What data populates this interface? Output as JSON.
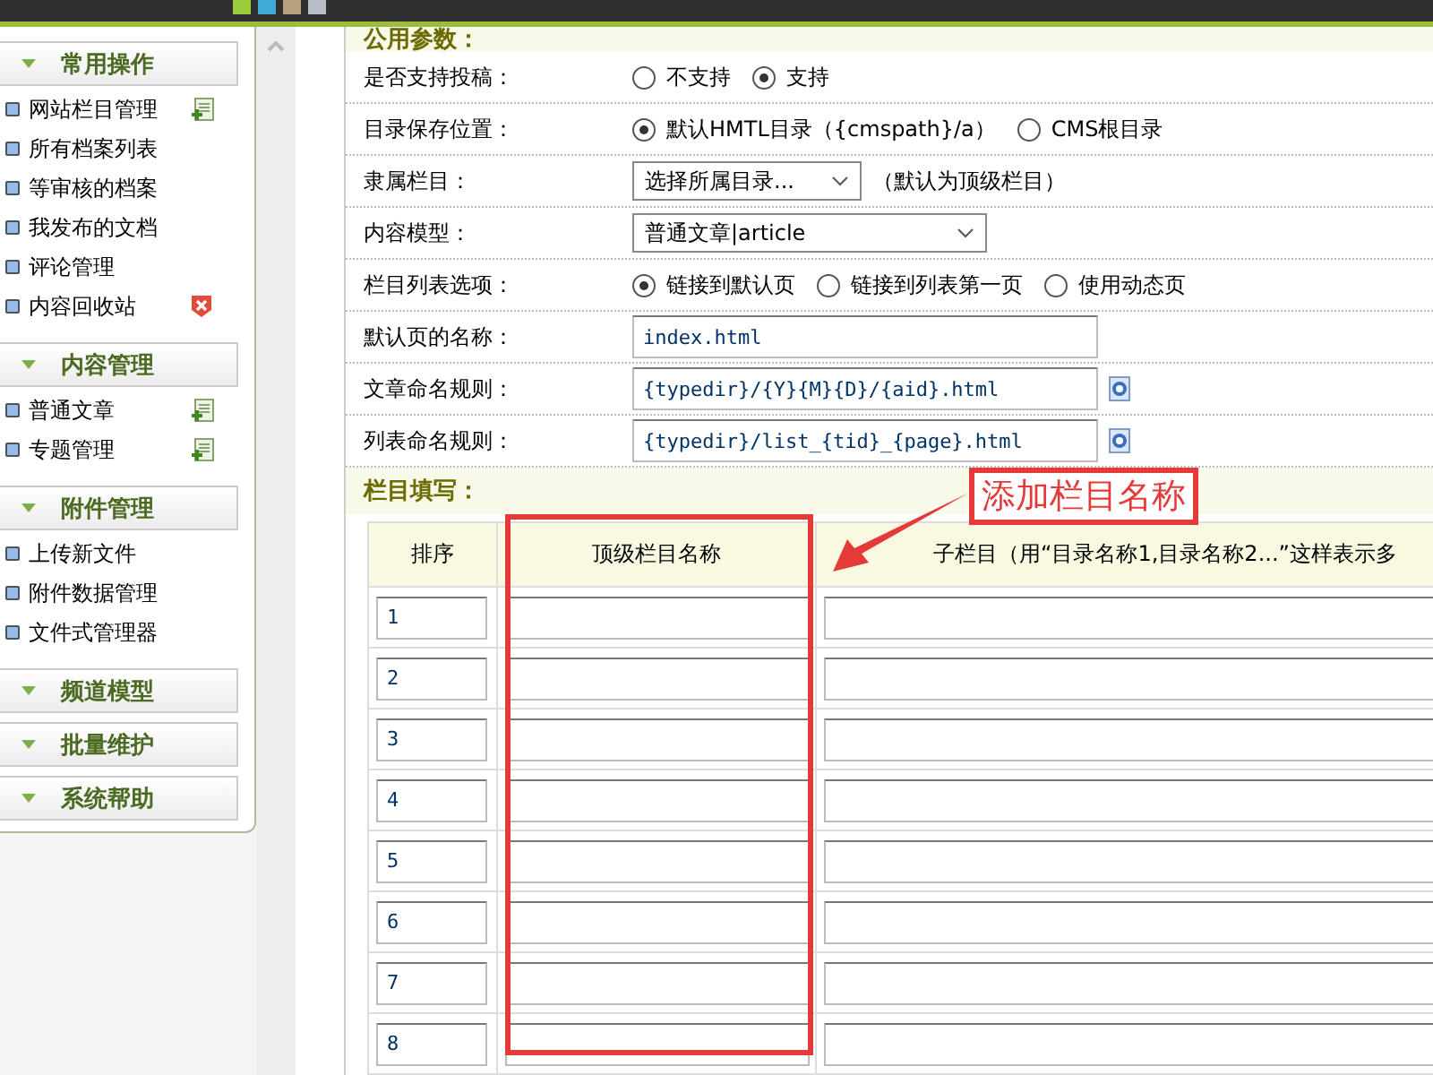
{
  "top_bar": {
    "swatches": [
      {
        "color": "#9ccc3c"
      },
      {
        "color": "#3fa9d8"
      },
      {
        "color": "#b8a17a"
      },
      {
        "color": "#b9bec4"
      }
    ]
  },
  "sidebar": {
    "groups": [
      {
        "title": "常用操作",
        "items": [
          {
            "label": "网站栏目管理",
            "kind": "add"
          },
          {
            "label": "所有档案列表",
            "kind": "plain"
          },
          {
            "label": "等审核的档案",
            "kind": "plain"
          },
          {
            "label": "我发布的文档",
            "kind": "plain"
          },
          {
            "label": "评论管理",
            "kind": "plain"
          },
          {
            "label": "内容回收站",
            "kind": "delete"
          }
        ]
      },
      {
        "title": "内容管理",
        "items": [
          {
            "label": "普通文章",
            "kind": "add"
          },
          {
            "label": "专题管理",
            "kind": "add"
          }
        ]
      },
      {
        "title": "附件管理",
        "items": [
          {
            "label": "上传新文件",
            "kind": "plain"
          },
          {
            "label": "附件数据管理",
            "kind": "plain"
          },
          {
            "label": "文件式管理器",
            "kind": "plain"
          }
        ]
      },
      {
        "title": "频道模型"
      },
      {
        "title": "批量维护"
      },
      {
        "title": "系统帮助"
      }
    ]
  },
  "form": {
    "section_title": "公用参数：",
    "rows": [
      {
        "kind": "radio",
        "label": "是否支持投稿：",
        "options": [
          {
            "label": "不支持",
            "selected": false
          },
          {
            "label": "支持",
            "selected": true
          }
        ]
      },
      {
        "kind": "radio",
        "label": "目录保存位置：",
        "options": [
          {
            "label": "默认HMTL目录（{cmspath}/a）",
            "selected": true
          },
          {
            "label": "CMS根目录",
            "selected": false
          }
        ]
      },
      {
        "kind": "select",
        "label": "隶属栏目：",
        "value": "选择所属目录...",
        "note": "（默认为顶级栏目）"
      },
      {
        "kind": "select",
        "label": "内容模型：",
        "value": "普通文章|article"
      },
      {
        "kind": "radio",
        "label": "栏目列表选项：",
        "options": [
          {
            "label": "链接到默认页",
            "selected": true
          },
          {
            "label": "链接到列表第一页",
            "selected": false
          },
          {
            "label": "使用动态页",
            "selected": false
          }
        ]
      },
      {
        "kind": "input",
        "label": "默认页的名称：",
        "value": "index.html"
      },
      {
        "kind": "input_help",
        "label": "文章命名规则：",
        "value": "{typedir}/{Y}{M}{D}/{aid}.html"
      },
      {
        "kind": "input_help",
        "label": "列表命名规则：",
        "value": "{typedir}/list_{tid}_{page}.html"
      }
    ]
  },
  "columns": {
    "section_title": "栏目填写：",
    "headers": [
      "排序",
      "顶级栏目名称",
      "子栏目（用“目录名称1,目录名称2...”这样表示多"
    ],
    "rows": [
      {
        "order": "1"
      },
      {
        "order": "2"
      },
      {
        "order": "3"
      },
      {
        "order": "4"
      },
      {
        "order": "5"
      },
      {
        "order": "6"
      },
      {
        "order": "7"
      },
      {
        "order": "8"
      }
    ]
  },
  "annotation": {
    "label": "添加栏目名称"
  }
}
